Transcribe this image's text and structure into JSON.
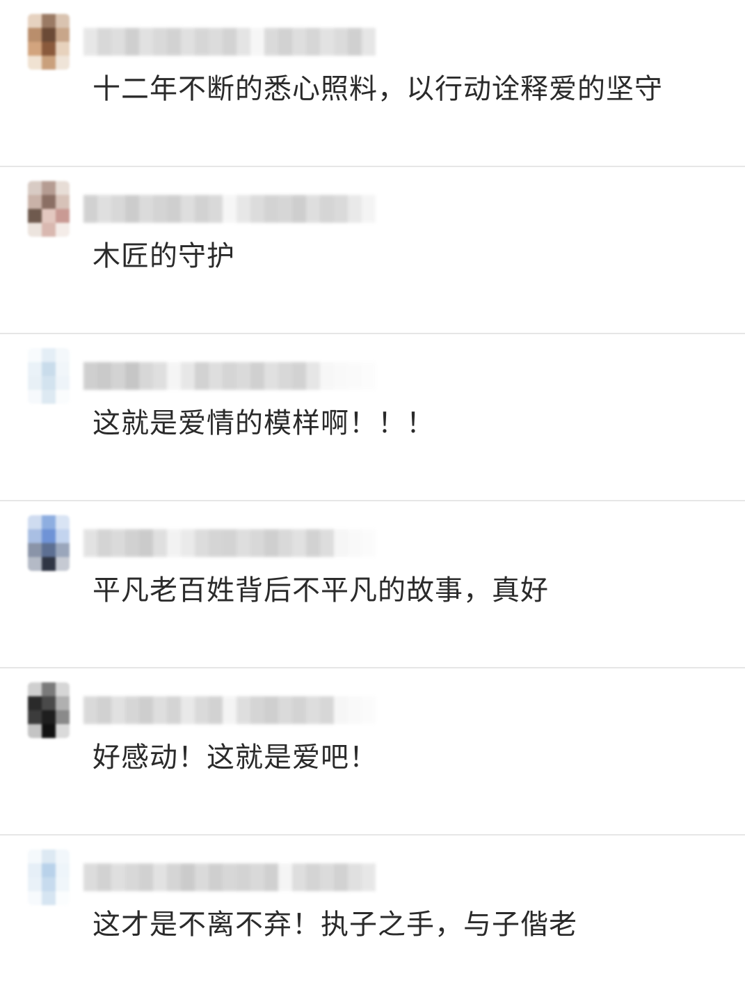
{
  "comments": [
    {
      "text": "十二年不断的悉心照料，以行动诠释爱的坚守",
      "avatar_colors": [
        "#e6d2c0",
        "#9a7a64",
        "#d9c3b0",
        "#b98e6c",
        "#6b4a36",
        "#c8a68a",
        "#d2a47e",
        "#8a5a3c",
        "#e7d2bd",
        "#f0e2d2",
        "#c9a07c",
        "#efe4d8"
      ],
      "username_shades": [
        "#e2e2e2",
        "#cfcfcf",
        "#d6d6d6",
        "#c4c4c4",
        "#dadada",
        "#d0d0d0",
        "#c8c8c8",
        "#d9d9d9",
        "#cdcdcd",
        "#d4d4d4",
        "#c9c9c9",
        "#dedede",
        "#f5f5f5",
        "#d2d2d2",
        "#c7c7c7",
        "#d6d6d6",
        "#cccccc",
        "#dcdcdc",
        "#d3d3d3",
        "#c5c5c5",
        "#e0e0e0"
      ]
    },
    {
      "text": "木匠的守护",
      "avatar_colors": [
        "#d8cbc4",
        "#b59c92",
        "#e7ddd6",
        "#c9b2a8",
        "#8b6f64",
        "#d7c2b8",
        "#6f5a4e",
        "#e3c8c0",
        "#c99a94",
        "#ece4de",
        "#d9b8b0",
        "#f4ece8"
      ],
      "username_shades": [
        "#c6c6c6",
        "#d8d8d8",
        "#cfcfcf",
        "#c0c0c0",
        "#d3d3d3",
        "#cacaca",
        "#c4c4c4",
        "#d6d6d6",
        "#c8c8c8",
        "#d0d0d0",
        "#f5f5f5",
        "#e2e2e2",
        "#d4d4d4",
        "#c9c9c9",
        "#cdcdcd",
        "#c3c3c3",
        "#d7d7d7",
        "#cbcbcb",
        "#d1d1d1",
        "#e4e4e4",
        "#f2f2f2"
      ]
    },
    {
      "text": "这就是爱情的模样啊！！！",
      "avatar_colors": [
        "#f8fbfd",
        "#e4eef6",
        "#f4f8fb",
        "#eaf2f8",
        "#c9dceb",
        "#f1f6fa",
        "#e8f0f6",
        "#d3e3ef",
        "#eef4f9",
        "#f6f9fc",
        "#dde9f2",
        "#fafcfd"
      ],
      "username_shades": [
        "#c4c4c4",
        "#bdbdbd",
        "#c9c9c9",
        "#b8b8b8",
        "#cecece",
        "#d8d8d8",
        "#f3f3f3",
        "#e2e2e2",
        "#c7c7c7",
        "#d6d6d6",
        "#cbcbcb",
        "#d2d2d2",
        "#c5c5c5",
        "#d9d9d9",
        "#cfcfcf",
        "#c8c8c8",
        "#e0e0e0",
        "#f6f6f6",
        "#f8f8f8",
        "#fafafa",
        "#fcfcfc"
      ]
    },
    {
      "text": "平凡老百姓背后不平凡的故事，真好",
      "avatar_colors": [
        "#cfdcf0",
        "#8eaee0",
        "#d9e4f4",
        "#a9bfe3",
        "#6f93d6",
        "#c3d4ef",
        "#8a94a8",
        "#5d6f92",
        "#9aa6bb",
        "#b4bac6",
        "#2f3544",
        "#c6cad3"
      ],
      "username_shades": [
        "#dcdcdc",
        "#cacaca",
        "#d2d2d2",
        "#c6c6c6",
        "#bfbfbf",
        "#d8d8d8",
        "#f0f0f0",
        "#e6e6e6",
        "#d4d4d4",
        "#cbcbcb",
        "#c9c9c9",
        "#d6d6d6",
        "#cfcfcf",
        "#c4c4c4",
        "#d0d0d0",
        "#dadada",
        "#c8c8c8",
        "#d5d5d5",
        "#f4f4f4",
        "#f8f8f8",
        "#fbfbfb"
      ]
    },
    {
      "text": "好感动！这就是爱吧！",
      "avatar_colors": [
        "#cfcfcf",
        "#7a7a7a",
        "#d6d6d6",
        "#2a2a2a",
        "#4a4a4a",
        "#b0b0b0",
        "#3c3c3c",
        "#1e1e1e",
        "#8a8a8a",
        "#c4c4c4",
        "#111111",
        "#dadada"
      ],
      "username_shades": [
        "#d0d0d0",
        "#c6c6c6",
        "#dadada",
        "#cdcdcd",
        "#c3c3c3",
        "#d6d6d6",
        "#cacaca",
        "#e4e4e4",
        "#d2d2d2",
        "#c8c8c8",
        "#f2f2f2",
        "#d7d7d7",
        "#cbcbcb",
        "#c4c4c4",
        "#d1d1d1",
        "#c9c9c9",
        "#d5d5d5",
        "#cecece",
        "#f5f5f5",
        "#f8f8f8",
        "#fbfbfb"
      ]
    },
    {
      "text": "这才是不离不弃！执子之手，与子偕老",
      "avatar_colors": [
        "#f5f9fc",
        "#dde9f3",
        "#f2f7fb",
        "#e6eff7",
        "#b9d2ea",
        "#eef5fa",
        "#e9f1f8",
        "#c7dbee",
        "#f0f6fa",
        "#f7fafd",
        "#d6e5f2",
        "#fbfdfe"
      ],
      "username_shades": [
        "#d4d4d4",
        "#c8c8c8",
        "#d8d8d8",
        "#cfcfcf",
        "#c6c6c6",
        "#dcdcdc",
        "#cbcbcb",
        "#bfbfbf",
        "#d2d2d2",
        "#c4c4c4",
        "#cecece",
        "#c9c9c9",
        "#d0d0d0",
        "#c5c5c5",
        "#f3f3f3",
        "#d6d6d6",
        "#cacaca",
        "#d3d3d3",
        "#c7c7c7",
        "#d9d9d9",
        "#e2e2e2"
      ]
    }
  ]
}
